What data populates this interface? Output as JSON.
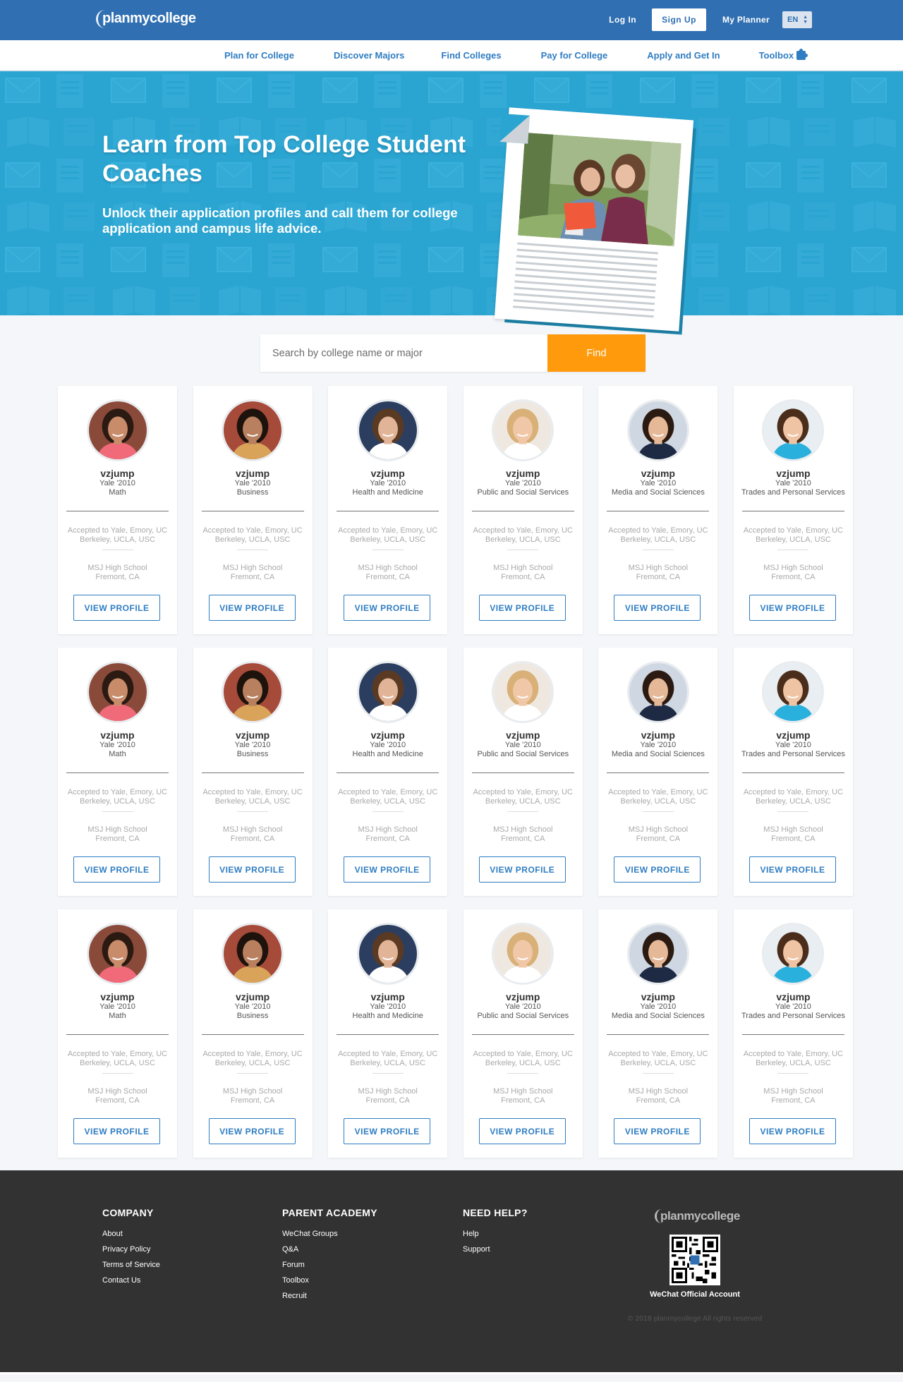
{
  "header": {
    "logo": "planmycollege",
    "login": "Log In",
    "signup": "Sign Up",
    "planner": "My Planner",
    "language": "EN"
  },
  "nav": {
    "items": [
      "Plan for College",
      "Discover Majors",
      "Find Colleges",
      "Pay for College",
      "Apply and Get In",
      "Toolbox"
    ]
  },
  "hero": {
    "title": "Learn from Top College Student Coaches",
    "subtitle": "Unlock their application profiles and call them for college application and campus life advice."
  },
  "search": {
    "placeholder": "Search by college name or major",
    "button": "Find"
  },
  "cards": [
    {
      "name": "vzjump",
      "year": "Yale '2010",
      "major": "Math",
      "accepted": "Accepted to Yale, Emory, UC Berkeley, UCLA, USC",
      "school": "MSJ High School",
      "location": "Fremont, CA",
      "button": "VIEW PROFILE",
      "avatar": "female-red-top"
    },
    {
      "name": "vzjump",
      "year": "Yale '2010",
      "major": "Business",
      "accepted": "Accepted to Yale, Emory, UC Berkeley, UCLA, USC",
      "school": "MSJ High School",
      "location": "Fremont, CA",
      "button": "VIEW PROFILE",
      "avatar": "female-books"
    },
    {
      "name": "vzjump",
      "year": "Yale '2010",
      "major": "Health and Medicine",
      "accepted": "Accepted to Yale, Emory, UC Berkeley, UCLA, USC",
      "school": "MSJ High School",
      "location": "Fremont, CA",
      "button": "VIEW PROFILE",
      "avatar": "female-short-hair"
    },
    {
      "name": "vzjump",
      "year": "Yale '2010",
      "major": "Public and Social Services",
      "accepted": "Accepted to Yale, Emory, UC Berkeley, UCLA, USC",
      "school": "MSJ High School",
      "location": "Fremont, CA",
      "button": "VIEW PROFILE",
      "avatar": "female-blonde"
    },
    {
      "name": "vzjump",
      "year": "Yale '2010",
      "major": "Media and Social Sciences",
      "accepted": "Accepted to Yale, Emory, UC Berkeley, UCLA, USC",
      "school": "MSJ High School",
      "location": "Fremont, CA",
      "button": "VIEW PROFILE",
      "avatar": "female-blazer"
    },
    {
      "name": "vzjump",
      "year": "Yale '2010",
      "major": "Trades and Personal Services",
      "accepted": "Accepted to Yale, Emory, UC Berkeley, UCLA, USC",
      "school": "MSJ High School",
      "location": "Fremont, CA",
      "button": "VIEW PROFILE",
      "avatar": "male-blue-shirt"
    },
    {
      "name": "vzjump",
      "year": "Yale '2010",
      "major": "Math",
      "accepted": "Accepted to Yale, Emory, UC Berkeley, UCLA, USC",
      "school": "MSJ High School",
      "location": "Fremont, CA",
      "button": "VIEW PROFILE",
      "avatar": "female-red-top"
    },
    {
      "name": "vzjump",
      "year": "Yale '2010",
      "major": "Business",
      "accepted": "Accepted to Yale, Emory, UC Berkeley, UCLA, USC",
      "school": "MSJ High School",
      "location": "Fremont, CA",
      "button": "VIEW PROFILE",
      "avatar": "female-books"
    },
    {
      "name": "vzjump",
      "year": "Yale '2010",
      "major": "Health and Medicine",
      "accepted": "Accepted to Yale, Emory, UC Berkeley, UCLA, USC",
      "school": "MSJ High School",
      "location": "Fremont, CA",
      "button": "VIEW PROFILE",
      "avatar": "female-short-hair"
    },
    {
      "name": "vzjump",
      "year": "Yale '2010",
      "major": "Public and Social Services",
      "accepted": "Accepted to Yale, Emory, UC Berkeley, UCLA, USC",
      "school": "MSJ High School",
      "location": "Fremont, CA",
      "button": "VIEW PROFILE",
      "avatar": "female-blonde"
    },
    {
      "name": "vzjump",
      "year": "Yale '2010",
      "major": "Media and Social Sciences",
      "accepted": "Accepted to Yale, Emory, UC Berkeley, UCLA, USC",
      "school": "MSJ High School",
      "location": "Fremont, CA",
      "button": "VIEW PROFILE",
      "avatar": "female-blazer"
    },
    {
      "name": "vzjump",
      "year": "Yale '2010",
      "major": "Trades and Personal Services",
      "accepted": "Accepted to Yale, Emory, UC Berkeley, UCLA, USC",
      "school": "MSJ High School",
      "location": "Fremont, CA",
      "button": "VIEW PROFILE",
      "avatar": "male-blue-shirt"
    },
    {
      "name": "vzjump",
      "year": "Yale '2010",
      "major": "Math",
      "accepted": "Accepted to Yale, Emory, UC Berkeley, UCLA, USC",
      "school": "MSJ High School",
      "location": "Fremont, CA",
      "button": "VIEW PROFILE",
      "avatar": "female-red-top"
    },
    {
      "name": "vzjump",
      "year": "Yale '2010",
      "major": "Business",
      "accepted": "Accepted to Yale, Emory, UC Berkeley, UCLA, USC",
      "school": "MSJ High School",
      "location": "Fremont, CA",
      "button": "VIEW PROFILE",
      "avatar": "female-books"
    },
    {
      "name": "vzjump",
      "year": "Yale '2010",
      "major": "Health and Medicine",
      "accepted": "Accepted to Yale, Emory, UC Berkeley, UCLA, USC",
      "school": "MSJ High School",
      "location": "Fremont, CA",
      "button": "VIEW PROFILE",
      "avatar": "female-short-hair"
    },
    {
      "name": "vzjump",
      "year": "Yale '2010",
      "major": "Public and Social Services",
      "accepted": "Accepted to Yale, Emory, UC Berkeley, UCLA, USC",
      "school": "MSJ High School",
      "location": "Fremont, CA",
      "button": "VIEW PROFILE",
      "avatar": "female-blonde"
    },
    {
      "name": "vzjump",
      "year": "Yale '2010",
      "major": "Media and Social Sciences",
      "accepted": "Accepted to Yale, Emory, UC Berkeley, UCLA, USC",
      "school": "MSJ High School",
      "location": "Fremont, CA",
      "button": "VIEW PROFILE",
      "avatar": "female-blazer"
    },
    {
      "name": "vzjump",
      "year": "Yale '2010",
      "major": "Trades and Personal Services",
      "accepted": "Accepted to Yale, Emory, UC Berkeley, UCLA, USC",
      "school": "MSJ High School",
      "location": "Fremont, CA",
      "button": "VIEW PROFILE",
      "avatar": "male-blue-shirt"
    }
  ],
  "footer": {
    "company": {
      "title": "COMPANY",
      "links": [
        "About",
        "Privacy Policy",
        "Terms of Service",
        "Contact Us"
      ]
    },
    "parent_academy": {
      "title": "PARENT ACADEMY",
      "links": [
        "WeChat Groups",
        "Q&A",
        "Forum",
        "Toolbox",
        "Recruit"
      ]
    },
    "need_help": {
      "title": "NEED HELP?",
      "links": [
        "Help",
        "Support"
      ]
    },
    "logo": "planmycollege",
    "qr_label": "WeChat Official Account",
    "copyright": "© 2018 planmycollege All rights reserved"
  },
  "colors": {
    "brand_blue": "#2f6fb2",
    "hero_blue": "#2aa4d1",
    "accent_orange": "#fe9a0b",
    "link_blue": "#2f7dc2",
    "footer_bg": "#323232"
  }
}
